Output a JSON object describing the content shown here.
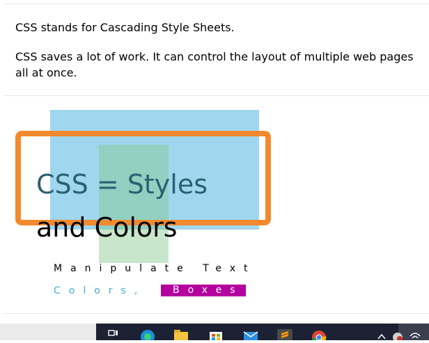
{
  "content": {
    "paragraph_1": "CSS stands for Cascading Style Sheets.",
    "paragraph_2": "CSS saves a lot of work. It can control the layout of multiple web pages all at once."
  },
  "demo": {
    "title_line_1": "CSS = Styles",
    "title_line_2": "and Colors",
    "subline_1": "Manipulate Text",
    "subline_2": "Colors,",
    "subline_highlight": "Boxes"
  },
  "taskbar": {
    "icons": [
      "task-view-icon",
      "edge-icon",
      "file-explorer-icon",
      "store-icon",
      "mail-icon",
      "sublime-text-icon",
      "chrome-icon",
      "tray-chevron-icon",
      "tray-network-icon",
      "tray-wifi-icon"
    ]
  },
  "colors": {
    "orange_frame": "#f28a2d",
    "blue_box": "#63bee4",
    "green_box": "#82c88c",
    "magenta_highlight": "#b4009e",
    "cyan_text": "#3cb0dc",
    "taskbar_dark": "#1c2133"
  }
}
